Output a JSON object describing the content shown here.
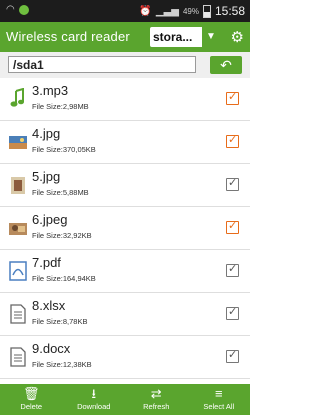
{
  "status": {
    "battery": "49%",
    "time": "15:58"
  },
  "header": {
    "title": "Wireless card reader",
    "storage_value": "stora..."
  },
  "pathbar": {
    "path": "/sda1"
  },
  "files": [
    {
      "name": "3.mp3",
      "size": "File Size:2,98MB",
      "icon": "music-note-icon",
      "checked": "orange"
    },
    {
      "name": "4.jpg",
      "size": "File Size:370,05KB",
      "icon": "image-icon",
      "checked": "orange"
    },
    {
      "name": "5.jpg",
      "size": "File Size:5,88MB",
      "icon": "image-icon",
      "checked": "gray"
    },
    {
      "name": "6.jpeg",
      "size": "File Size:32,92KB",
      "icon": "image-icon",
      "checked": "orange"
    },
    {
      "name": "7.pdf",
      "size": "File Size:164,94KB",
      "icon": "pdf-icon",
      "checked": "gray"
    },
    {
      "name": "8.xlsx",
      "size": "File Size:8,78KB",
      "icon": "document-icon",
      "checked": "gray"
    },
    {
      "name": "9.docx",
      "size": "File Size:12,38KB",
      "icon": "document-icon",
      "checked": "gray"
    }
  ],
  "toolbar": {
    "delete_label": "Delete",
    "download_label": "Download",
    "refresh_label": "Refresh",
    "select_all_label": "Select All"
  },
  "colors": {
    "brand": "#5aa52e",
    "check_orange": "#e86c1a"
  }
}
